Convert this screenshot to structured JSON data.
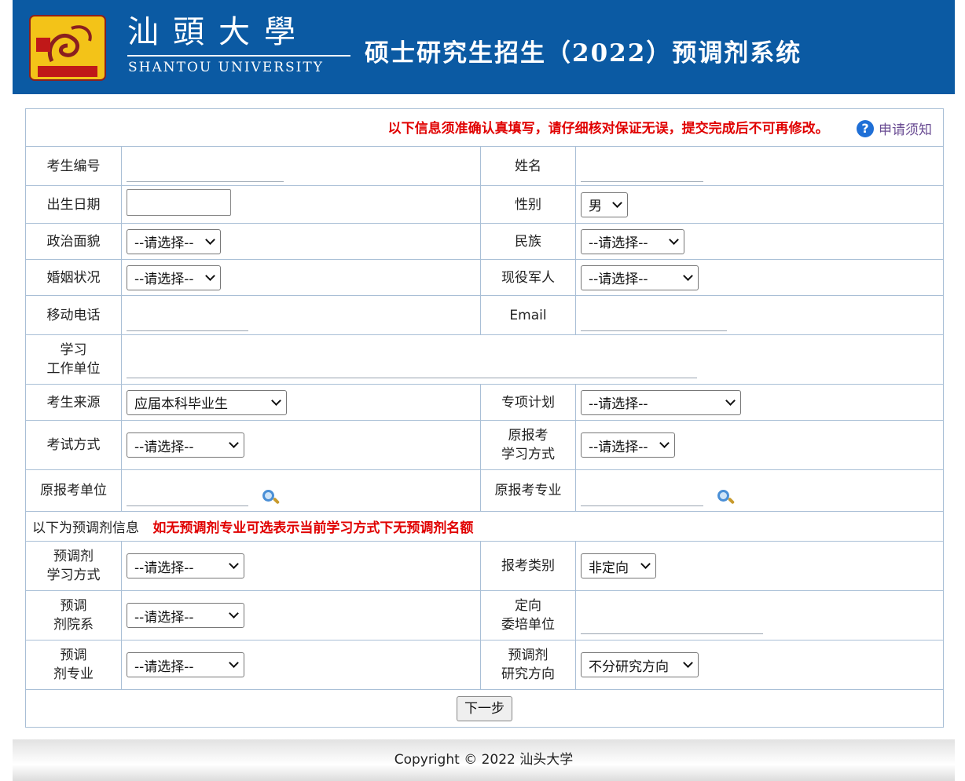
{
  "header": {
    "logo_cn": "汕頭大學",
    "logo_en": "SHANTOU UNIVERSITY",
    "system_title": "硕士研究生招生（2022）预调剂系统"
  },
  "notice": {
    "text": "以下信息须准确认真填写，请仔细核对保证无误，提交完成后不可再修改。",
    "help_label": "申请须知",
    "help_glyph": "?"
  },
  "form": {
    "exam_no_label": "考生编号",
    "name_label": "姓名",
    "birthdate_label": "出生日期",
    "gender_label": "性别",
    "gender_value": "男",
    "political_label": "政治面貌",
    "political_value": "--请选择--",
    "ethnicity_label": "民族",
    "ethnicity_value": "--请选择--",
    "marital_label": "婚姻状况",
    "marital_value": "--请选择--",
    "military_label": "现役军人",
    "military_value": "--请选择--",
    "mobile_label": "移动电话",
    "email_label": "Email",
    "workplace_label_1": "学习",
    "workplace_label_2": "工作单位",
    "source_label": "考生来源",
    "source_value": "应届本科毕业生",
    "special_plan_label": "专项计划",
    "special_plan_value": "--请选择--",
    "exam_mode_label": "考试方式",
    "exam_mode_value": "--请选择--",
    "orig_study_label_1": "原报考",
    "orig_study_label_2": "学习方式",
    "orig_study_value": "--请选择--",
    "orig_unit_label": "原报考单位",
    "orig_major_label": "原报考专业"
  },
  "section": {
    "label": "以下为预调剂信息",
    "warning": "如无预调剂专业可选表示当前学习方式下无预调剂名额"
  },
  "adjust": {
    "study_mode_label_1": "预调剂",
    "study_mode_label_2": "学习方式",
    "study_mode_value": "--请选择--",
    "category_label": "报考类别",
    "category_value": "非定向",
    "dept_label_1": "预调",
    "dept_label_2": "剂院系",
    "dept_value": "--请选择--",
    "sponsor_label_1": "定向",
    "sponsor_label_2": "委培单位",
    "major_label_1": "预调",
    "major_label_2": "剂专业",
    "major_value": "--请选择--",
    "direction_label_1": "预调剂",
    "direction_label_2": "研究方向",
    "direction_value": "不分研究方向"
  },
  "actions": {
    "next_label": "下一步"
  },
  "footer": {
    "copyright": "Copyright © 2022 汕头大学"
  },
  "colors": {
    "header_bg": "#0b5aa3",
    "warning": "#e00000",
    "border": "#a9bfd6"
  }
}
